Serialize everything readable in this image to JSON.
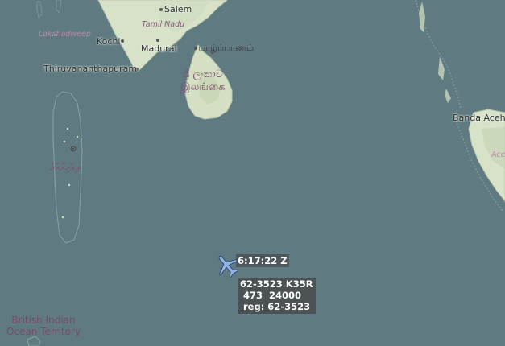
{
  "map": {
    "water_color": "#5f7a81",
    "land_color": "#d7e2c9",
    "labels": {
      "salem": "Salem",
      "tamil_nadu": "Tamil Nadu",
      "kochi": "Kochi",
      "madurai": "Madurai",
      "yazhpanam": "யாழ்ப்பாணம்",
      "lakshadweep": "Lakshadweep",
      "thiruvananthapuram": "Thiruvananthapuram",
      "sri_lanka_line1": "ශ්‍රී ලංකාව",
      "sri_lanka_line2": "இலங்கை",
      "maldives_script": "ދިވެހިރާއްޖެ",
      "banda_aceh": "Banda Aceh",
      "aceh": "Ace",
      "biot_line1": "British Indian",
      "biot_line2": "Ocean Territory"
    }
  },
  "aircraft": {
    "icon": "airplane-icon",
    "color": "#8fb4e8",
    "time_label": "6:17:22 Z",
    "callsign_line": "62-3523 K35R",
    "speed_alt_line": " 473  24000",
    "reg_line": " reg: 62-3523"
  }
}
